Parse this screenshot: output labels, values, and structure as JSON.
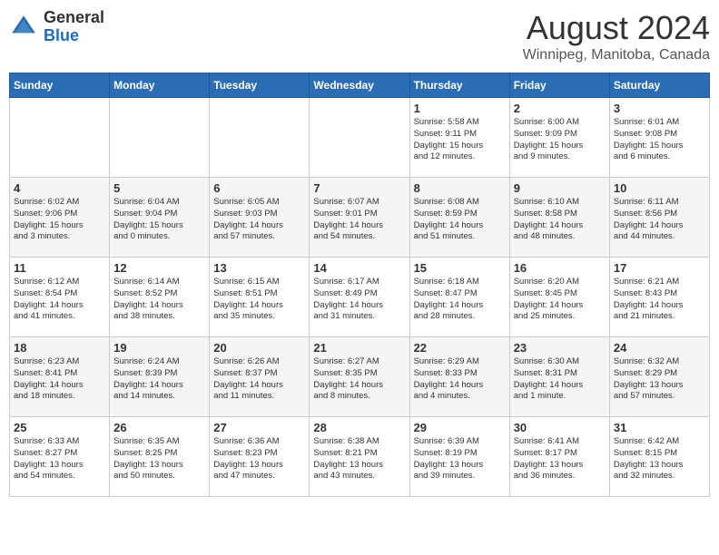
{
  "header": {
    "logo_general": "General",
    "logo_blue": "Blue",
    "month_year": "August 2024",
    "location": "Winnipeg, Manitoba, Canada"
  },
  "days_of_week": [
    "Sunday",
    "Monday",
    "Tuesday",
    "Wednesday",
    "Thursday",
    "Friday",
    "Saturday"
  ],
  "weeks": [
    [
      {
        "day": "",
        "info": ""
      },
      {
        "day": "",
        "info": ""
      },
      {
        "day": "",
        "info": ""
      },
      {
        "day": "",
        "info": ""
      },
      {
        "day": "1",
        "info": "Sunrise: 5:58 AM\nSunset: 9:11 PM\nDaylight: 15 hours\nand 12 minutes."
      },
      {
        "day": "2",
        "info": "Sunrise: 6:00 AM\nSunset: 9:09 PM\nDaylight: 15 hours\nand 9 minutes."
      },
      {
        "day": "3",
        "info": "Sunrise: 6:01 AM\nSunset: 9:08 PM\nDaylight: 15 hours\nand 6 minutes."
      }
    ],
    [
      {
        "day": "4",
        "info": "Sunrise: 6:02 AM\nSunset: 9:06 PM\nDaylight: 15 hours\nand 3 minutes."
      },
      {
        "day": "5",
        "info": "Sunrise: 6:04 AM\nSunset: 9:04 PM\nDaylight: 15 hours\nand 0 minutes."
      },
      {
        "day": "6",
        "info": "Sunrise: 6:05 AM\nSunset: 9:03 PM\nDaylight: 14 hours\nand 57 minutes."
      },
      {
        "day": "7",
        "info": "Sunrise: 6:07 AM\nSunset: 9:01 PM\nDaylight: 14 hours\nand 54 minutes."
      },
      {
        "day": "8",
        "info": "Sunrise: 6:08 AM\nSunset: 8:59 PM\nDaylight: 14 hours\nand 51 minutes."
      },
      {
        "day": "9",
        "info": "Sunrise: 6:10 AM\nSunset: 8:58 PM\nDaylight: 14 hours\nand 48 minutes."
      },
      {
        "day": "10",
        "info": "Sunrise: 6:11 AM\nSunset: 8:56 PM\nDaylight: 14 hours\nand 44 minutes."
      }
    ],
    [
      {
        "day": "11",
        "info": "Sunrise: 6:12 AM\nSunset: 8:54 PM\nDaylight: 14 hours\nand 41 minutes."
      },
      {
        "day": "12",
        "info": "Sunrise: 6:14 AM\nSunset: 8:52 PM\nDaylight: 14 hours\nand 38 minutes."
      },
      {
        "day": "13",
        "info": "Sunrise: 6:15 AM\nSunset: 8:51 PM\nDaylight: 14 hours\nand 35 minutes."
      },
      {
        "day": "14",
        "info": "Sunrise: 6:17 AM\nSunset: 8:49 PM\nDaylight: 14 hours\nand 31 minutes."
      },
      {
        "day": "15",
        "info": "Sunrise: 6:18 AM\nSunset: 8:47 PM\nDaylight: 14 hours\nand 28 minutes."
      },
      {
        "day": "16",
        "info": "Sunrise: 6:20 AM\nSunset: 8:45 PM\nDaylight: 14 hours\nand 25 minutes."
      },
      {
        "day": "17",
        "info": "Sunrise: 6:21 AM\nSunset: 8:43 PM\nDaylight: 14 hours\nand 21 minutes."
      }
    ],
    [
      {
        "day": "18",
        "info": "Sunrise: 6:23 AM\nSunset: 8:41 PM\nDaylight: 14 hours\nand 18 minutes."
      },
      {
        "day": "19",
        "info": "Sunrise: 6:24 AM\nSunset: 8:39 PM\nDaylight: 14 hours\nand 14 minutes."
      },
      {
        "day": "20",
        "info": "Sunrise: 6:26 AM\nSunset: 8:37 PM\nDaylight: 14 hours\nand 11 minutes."
      },
      {
        "day": "21",
        "info": "Sunrise: 6:27 AM\nSunset: 8:35 PM\nDaylight: 14 hours\nand 8 minutes."
      },
      {
        "day": "22",
        "info": "Sunrise: 6:29 AM\nSunset: 8:33 PM\nDaylight: 14 hours\nand 4 minutes."
      },
      {
        "day": "23",
        "info": "Sunrise: 6:30 AM\nSunset: 8:31 PM\nDaylight: 14 hours\nand 1 minute."
      },
      {
        "day": "24",
        "info": "Sunrise: 6:32 AM\nSunset: 8:29 PM\nDaylight: 13 hours\nand 57 minutes."
      }
    ],
    [
      {
        "day": "25",
        "info": "Sunrise: 6:33 AM\nSunset: 8:27 PM\nDaylight: 13 hours\nand 54 minutes."
      },
      {
        "day": "26",
        "info": "Sunrise: 6:35 AM\nSunset: 8:25 PM\nDaylight: 13 hours\nand 50 minutes."
      },
      {
        "day": "27",
        "info": "Sunrise: 6:36 AM\nSunset: 8:23 PM\nDaylight: 13 hours\nand 47 minutes."
      },
      {
        "day": "28",
        "info": "Sunrise: 6:38 AM\nSunset: 8:21 PM\nDaylight: 13 hours\nand 43 minutes."
      },
      {
        "day": "29",
        "info": "Sunrise: 6:39 AM\nSunset: 8:19 PM\nDaylight: 13 hours\nand 39 minutes."
      },
      {
        "day": "30",
        "info": "Sunrise: 6:41 AM\nSunset: 8:17 PM\nDaylight: 13 hours\nand 36 minutes."
      },
      {
        "day": "31",
        "info": "Sunrise: 6:42 AM\nSunset: 8:15 PM\nDaylight: 13 hours\nand 32 minutes."
      }
    ]
  ]
}
